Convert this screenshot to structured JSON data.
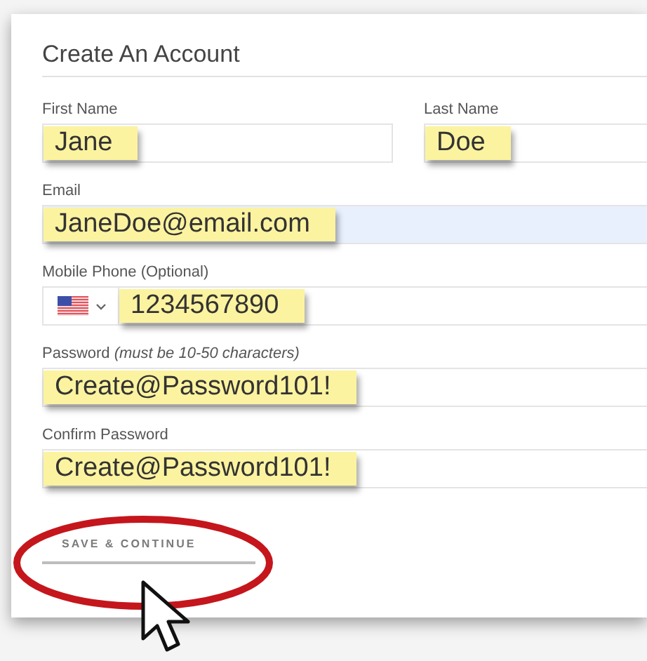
{
  "form": {
    "title": "Create An Account",
    "rows": [
      [
        {
          "kind": "text",
          "label": "First Name",
          "value": "Jane",
          "focused": false
        },
        {
          "kind": "text",
          "label": "Last Name",
          "value": "Doe",
          "focused": false
        }
      ],
      [
        {
          "kind": "text",
          "label": "Email",
          "value": "JaneDoe@email.com",
          "focused": true
        }
      ],
      [
        {
          "kind": "phone",
          "label": "Mobile Phone (Optional)",
          "value": "1234567890",
          "focused": false
        }
      ],
      [
        {
          "kind": "text",
          "label": "Password *(must be 10-50 characters)*",
          "value": "Create@Password101!",
          "focused": false
        }
      ],
      [
        {
          "kind": "text",
          "label": "Confirm Password",
          "value": "Create@Password101!",
          "focused": false
        }
      ]
    ],
    "button": "SAVE & CONTINUE"
  }
}
